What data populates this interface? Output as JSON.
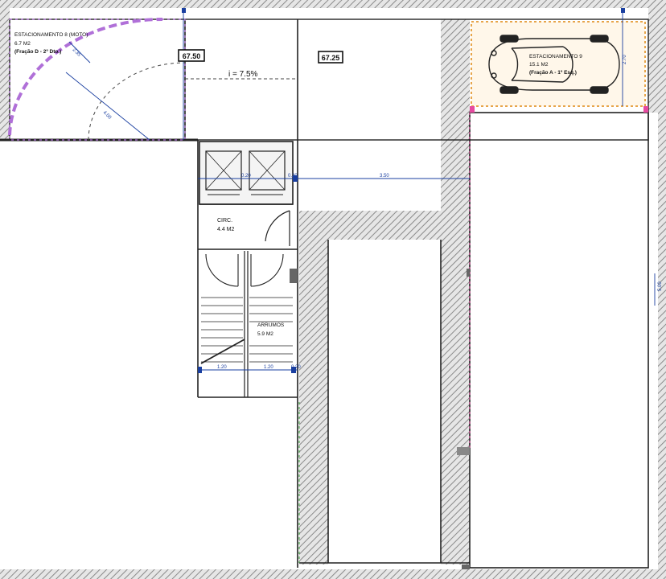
{
  "rooms": {
    "parking_moto": {
      "name": "ESTACIONAMENTO 8 (MOTO)",
      "area": "6.7 M2",
      "owner": "(Fração D - 2º Dto.)"
    },
    "parking_car": {
      "name": "ESTACIONAMENTO 9",
      "area": "15.1 M2",
      "owner": "(Fração A - 1º Esq.)"
    },
    "circulation": {
      "name": "CIRC.",
      "area": "4.4 M2"
    },
    "storage": {
      "name": "ARRUMOS",
      "area": "5.9 M2"
    }
  },
  "levels": {
    "left": "67.50",
    "right": "67.25"
  },
  "slope": "i = 7.5%",
  "dimensions": {
    "radius_a": "2.35",
    "radius_b": "4.00",
    "corridor_width": "3.50",
    "stair_left": "1.20",
    "stair_right": "1.20",
    "small_a": "0.20",
    "small_b": "0.20",
    "small_c": "0.20",
    "parking_side": "2.70",
    "right_edge": "5.00"
  }
}
